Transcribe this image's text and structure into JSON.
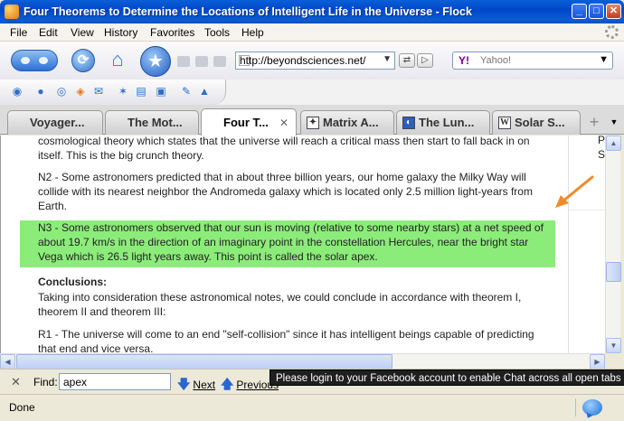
{
  "window": {
    "title": "Four Theorems to Determine the Locations of Intelligent Life in the Universe - Flock",
    "minimize": "_",
    "maximize": "□",
    "close": "✕"
  },
  "menu": [
    "File",
    "Edit",
    "View",
    "History",
    "Favorites",
    "Tools",
    "Help"
  ],
  "navbar": {
    "url": "http://beyondsciences.net/",
    "search_placeholder": "Yahoo!",
    "search_provider": "Y!"
  },
  "tabs": [
    {
      "label": "Voyager..."
    },
    {
      "label": "The Mot..."
    },
    {
      "label": "Four T...",
      "active": true
    },
    {
      "label": "Matrix A..."
    },
    {
      "label": "The Lun..."
    },
    {
      "label": "Solar S..."
    }
  ],
  "content": {
    "p0": "cosmological theory which states that the universe will reach a critical mass then start to fall back in on itself. This is the big crunch theory.",
    "p1": "N2 - Some astronomers predicted that in about three billion years, our home galaxy the Milky Way will collide with its nearest neighbor the Andromeda galaxy which is located only 2.5 million light-years from Earth.",
    "p2": "N3 - Some astronomers observed that our sun is moving (relative to some nearby stars) at a net speed of about 19.7 km/s in the direction of an imaginary point in the constellation Hercules, near the bright star Vega which is 26.5 light years away. This point is called the solar apex.",
    "heading": "Conclusions:",
    "p3": "Taking into consideration these astronomical notes, we could conclude in accordance with theorem I, theorem II and theorem III:",
    "p4": "R1 - The universe will come to an end \"self-collision\" since it has intelligent beings capable of predicting that end and vice versa.",
    "side_p": "P",
    "side_s": "S"
  },
  "findbar": {
    "close": "✕",
    "label": "Find:",
    "value": "apex",
    "next": "Next",
    "previous": "Previous"
  },
  "tooltip": "Please login to your Facebook account to enable Chat across all open tabs",
  "status": "Done",
  "colors": {
    "highlight": "#8cec7a",
    "arrow": "#f08a2a",
    "titlebar": "#0a5fd8"
  }
}
